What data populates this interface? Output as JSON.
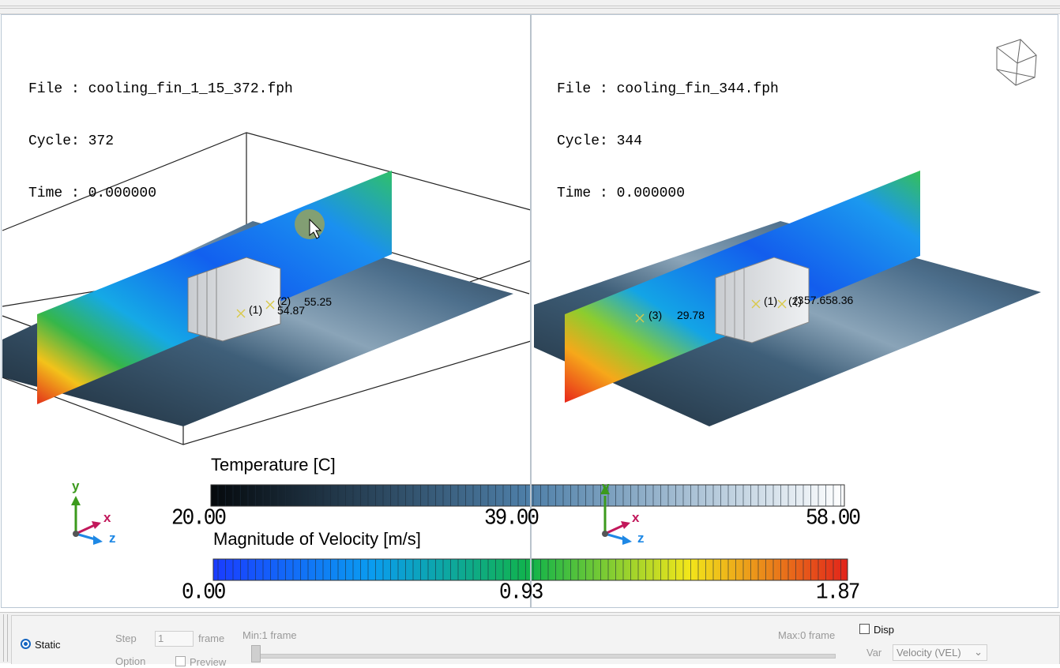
{
  "left_view": {
    "file_label": "File : cooling_fin_1_15_372.fph",
    "cycle_label": "Cycle: 372",
    "time_label": "Time : 0.000000",
    "probes": [
      {
        "id": "(1)",
        "value": "54.87"
      },
      {
        "id": "(2)",
        "value": "55.25"
      }
    ]
  },
  "right_view": {
    "file_label": "File : cooling_fin_344.fph",
    "cycle_label": "Cycle: 344",
    "time_label": "Time : 0.000000",
    "probes": [
      {
        "id": "(3)",
        "value": "29.78"
      },
      {
        "id": "(1)",
        "value": "(2)"
      },
      {
        "id": "(3",
        "value": "57.658.36"
      }
    ],
    "view_cube_icon": "view-cube-icon"
  },
  "legend_temperature": {
    "title": "Temperature [C]",
    "min": "20.00",
    "mid": "39.00",
    "max": "58.00",
    "color_low": "#05090c",
    "color_mid": "#4e7fa8",
    "color_high": "#ffffff"
  },
  "legend_velocity": {
    "title": "Magnitude of Velocity [m/s]",
    "min": "0.00",
    "mid": "0.93",
    "max": "1.87",
    "colors": [
      "#1a3cff",
      "#0a9cf0",
      "#11b34a",
      "#f2e61a",
      "#e2231a"
    ]
  },
  "axes": {
    "x": "x",
    "y": "y",
    "z": "z",
    "color_x": "#c2185b",
    "color_y": "#3c9a1d",
    "color_z": "#1e88e5"
  },
  "controls": {
    "static_label": "Static",
    "step_label": "Step",
    "step_value": "1",
    "frame_label": "frame",
    "option_label": "Option",
    "preview_label": "Preview",
    "min_label": "Min:1  frame",
    "max_label": "Max:0 frame",
    "disp_label": "Disp",
    "var_label": "Var",
    "var_value": "Velocity (VEL)"
  }
}
